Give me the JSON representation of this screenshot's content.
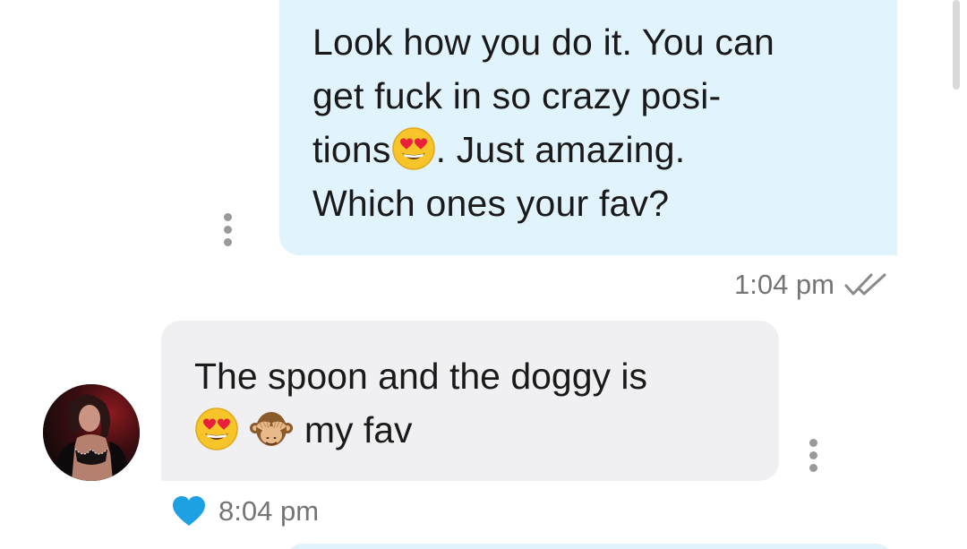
{
  "conversation": {
    "outgoing": {
      "text": "Look how you do it. You can\nget fuck in so crazy posi-\ntions",
      "text_after_emoji": ". Just amazing.\nWhich ones your fav?",
      "emoji": "heart-eyes-emoji",
      "time": "1:04 pm",
      "status_icon": "double-check-icon"
    },
    "incoming": {
      "text_line1": "The spoon and the doggy is",
      "text_line2": "my fav",
      "emojis": [
        "heart-eyes-emoji",
        "see-no-evil-monkey-emoji"
      ],
      "time": "8:04 pm",
      "reaction_icon": "heart-icon"
    }
  },
  "colors": {
    "outgoing_bubble": "#e1f3fc",
    "incoming_bubble": "#f0f0f2",
    "heart": "#1da1e2",
    "timestamp": "#757575"
  }
}
